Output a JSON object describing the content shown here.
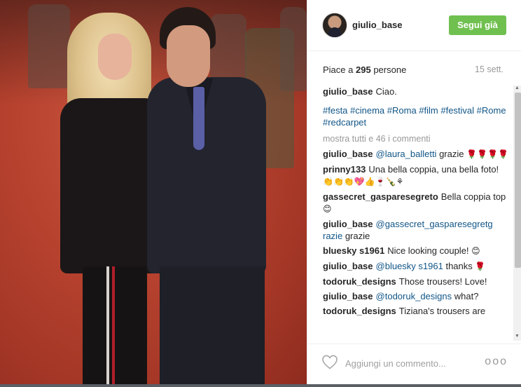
{
  "post": {
    "username": "giulio_base",
    "follow_label": "Segui già",
    "likes_prefix": "Piace a",
    "likes_count": "295",
    "likes_suffix": "persone",
    "time_ago": "15 sett.",
    "caption_user": "giulio_base",
    "caption_text": "Ciao.",
    "hashtags": "#festa #cinema #Roma #film #festival #Rome #redcarpet",
    "show_all_comments": "mostra tutti e 46 i commenti"
  },
  "comments": [
    {
      "user": "giulio_base",
      "mention": "@laura_balletti",
      "text": "grazie",
      "emoji": "🌹🌹🌹🌹"
    },
    {
      "user": "prinny133",
      "mention": "",
      "text": "Una bella coppia, una bella foto!",
      "emoji": "👏👏👏💖👍🍷🍾⚘"
    },
    {
      "user": "gassecret_gasparesegreto",
      "mention": "",
      "text": "Bella coppia top",
      "emoji": "😊"
    },
    {
      "user": "giulio_base",
      "mention": "@gassecret_gasparesegretg razie",
      "text": "grazie",
      "emoji": ""
    },
    {
      "user": "bluesky s1961",
      "mention": "",
      "text": "Nice looking couple!",
      "emoji": "😊"
    },
    {
      "user": "giulio_base",
      "mention": "@bluesky s1961",
      "text": "thanks",
      "emoji": "🌹"
    },
    {
      "user": "todoruk_designs",
      "mention": "",
      "text": "Those trousers! Love!",
      "emoji": ""
    },
    {
      "user": "giulio_base",
      "mention": "@todoruk_designs",
      "text": "what?",
      "emoji": ""
    },
    {
      "user": "todoruk_designs",
      "mention": "",
      "text": "Tiziana's trousers are",
      "emoji": ""
    }
  ],
  "footer": {
    "comment_placeholder": "Aggiungi un commento...",
    "more_options": "ooo"
  },
  "colors": {
    "follow_green": "#70c050",
    "link_blue": "#125688",
    "text_dark": "#262626",
    "muted_gray": "#999999"
  },
  "icons": {
    "like": "heart-icon",
    "options": "more-options-icon"
  }
}
